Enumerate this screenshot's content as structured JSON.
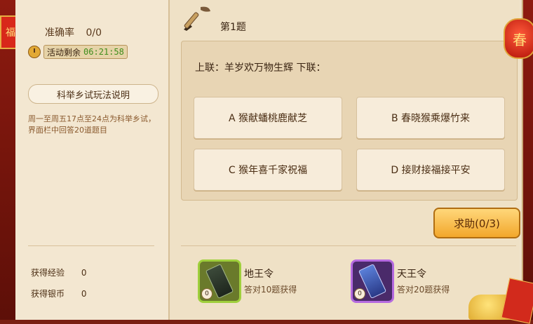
{
  "accuracy": {
    "label": "准确率",
    "value": "0/0"
  },
  "timer": {
    "label": "活动剩余",
    "time": "06:21:58"
  },
  "rules": {
    "title": "科举乡试玩法说明",
    "text": "周一至周五17点至24点为科举乡试，界面栏中回答20道题目"
  },
  "rewards": [
    {
      "label": "获得经验",
      "value": "0"
    },
    {
      "label": "获得银币",
      "value": "0"
    }
  ],
  "question": {
    "number": "第1题",
    "text": "上联：羊岁欢万物生辉 下联：",
    "options": [
      {
        "text": "A 猴献蟠桃鹿献芝"
      },
      {
        "text": "B 春晓猴乘爆竹来"
      },
      {
        "text": "C 猴年喜千家祝福"
      },
      {
        "text": "D 接财接福接平安"
      }
    ]
  },
  "help_button": {
    "label": "求助(0/3)"
  },
  "items": [
    {
      "name": "地王令",
      "desc": "答对10题获得",
      "qty": "0",
      "icon": "scroll-icon-dark"
    },
    {
      "name": "天王令",
      "desc": "答对20题获得",
      "qty": "0",
      "icon": "scroll-icon-blue"
    }
  ],
  "decorations": {
    "fu": "福",
    "lantern": "春"
  }
}
